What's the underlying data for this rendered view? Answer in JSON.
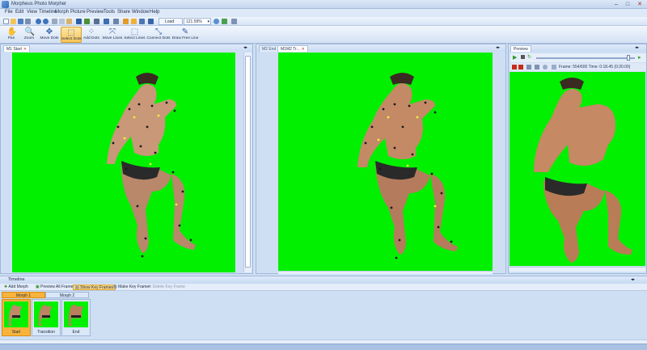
{
  "app": {
    "title": "Morpheus Photo Morpher"
  },
  "window_controls": {
    "minimize": "–",
    "maximize": "□",
    "close": "✕"
  },
  "menu": [
    "File",
    "Edit",
    "View",
    "Timeline",
    "Morph",
    "Picture",
    "Preview",
    "Tools",
    "Share",
    "Window",
    "Help"
  ],
  "small_toolbar": {
    "load_pictures": "Load Picture...",
    "zoom": "121.59%"
  },
  "tools": [
    {
      "label": "Pan",
      "icon": "hand-icon",
      "glyph": "✋",
      "active": false
    },
    {
      "label": "Zoom",
      "icon": "magnifier-icon",
      "glyph": "🔍",
      "active": false
    },
    {
      "label": "Move Dots",
      "icon": "move-dots-icon",
      "glyph": "✥",
      "active": false
    },
    {
      "label": "Select Dots",
      "icon": "select-dots-icon",
      "glyph": "⬚",
      "active": true
    },
    {
      "label": "Add Dots",
      "icon": "add-dots-icon",
      "glyph": "⁘",
      "active": false
    },
    {
      "label": "Move Lines",
      "icon": "move-lines-icon",
      "glyph": "⤧",
      "active": false
    },
    {
      "label": "Select Lines",
      "icon": "select-lines-icon",
      "glyph": "⬚",
      "active": false
    },
    {
      "label": "Connect Dots",
      "icon": "connect-dots-icon",
      "glyph": "⤡",
      "active": false
    },
    {
      "label": "Draw Free Line",
      "icon": "draw-line-icon",
      "glyph": "✎",
      "active": false
    }
  ],
  "panels": {
    "start": {
      "tab": "M1 Start"
    },
    "end_tabs": [
      {
        "label": "M2 End",
        "active": false
      },
      {
        "label": "M1M2 Tr...",
        "active": true
      }
    ],
    "preview": {
      "tab": "Preview",
      "frame_info": "Frame: 554/600  Time: 0:18.45 (0:20.00)"
    }
  },
  "timeline": {
    "title": "Timeline",
    "tools": [
      {
        "label": "Add Morph",
        "state": "normal"
      },
      {
        "label": "Preview All Frames",
        "state": "normal"
      },
      {
        "label": "Show Key Frames",
        "state": "on"
      },
      {
        "label": "Make Key Frame",
        "state": "normal"
      },
      {
        "label": "Delete Key Frame",
        "state": "disabled"
      }
    ],
    "morphs": [
      "Morph 1",
      "Morph 2"
    ],
    "frames": [
      "Start",
      "Transition",
      "End"
    ]
  },
  "colors": {
    "canvas_green": "#00f000",
    "accent_orange": "#f7b43c",
    "chrome_blue": "#cfdff3"
  }
}
